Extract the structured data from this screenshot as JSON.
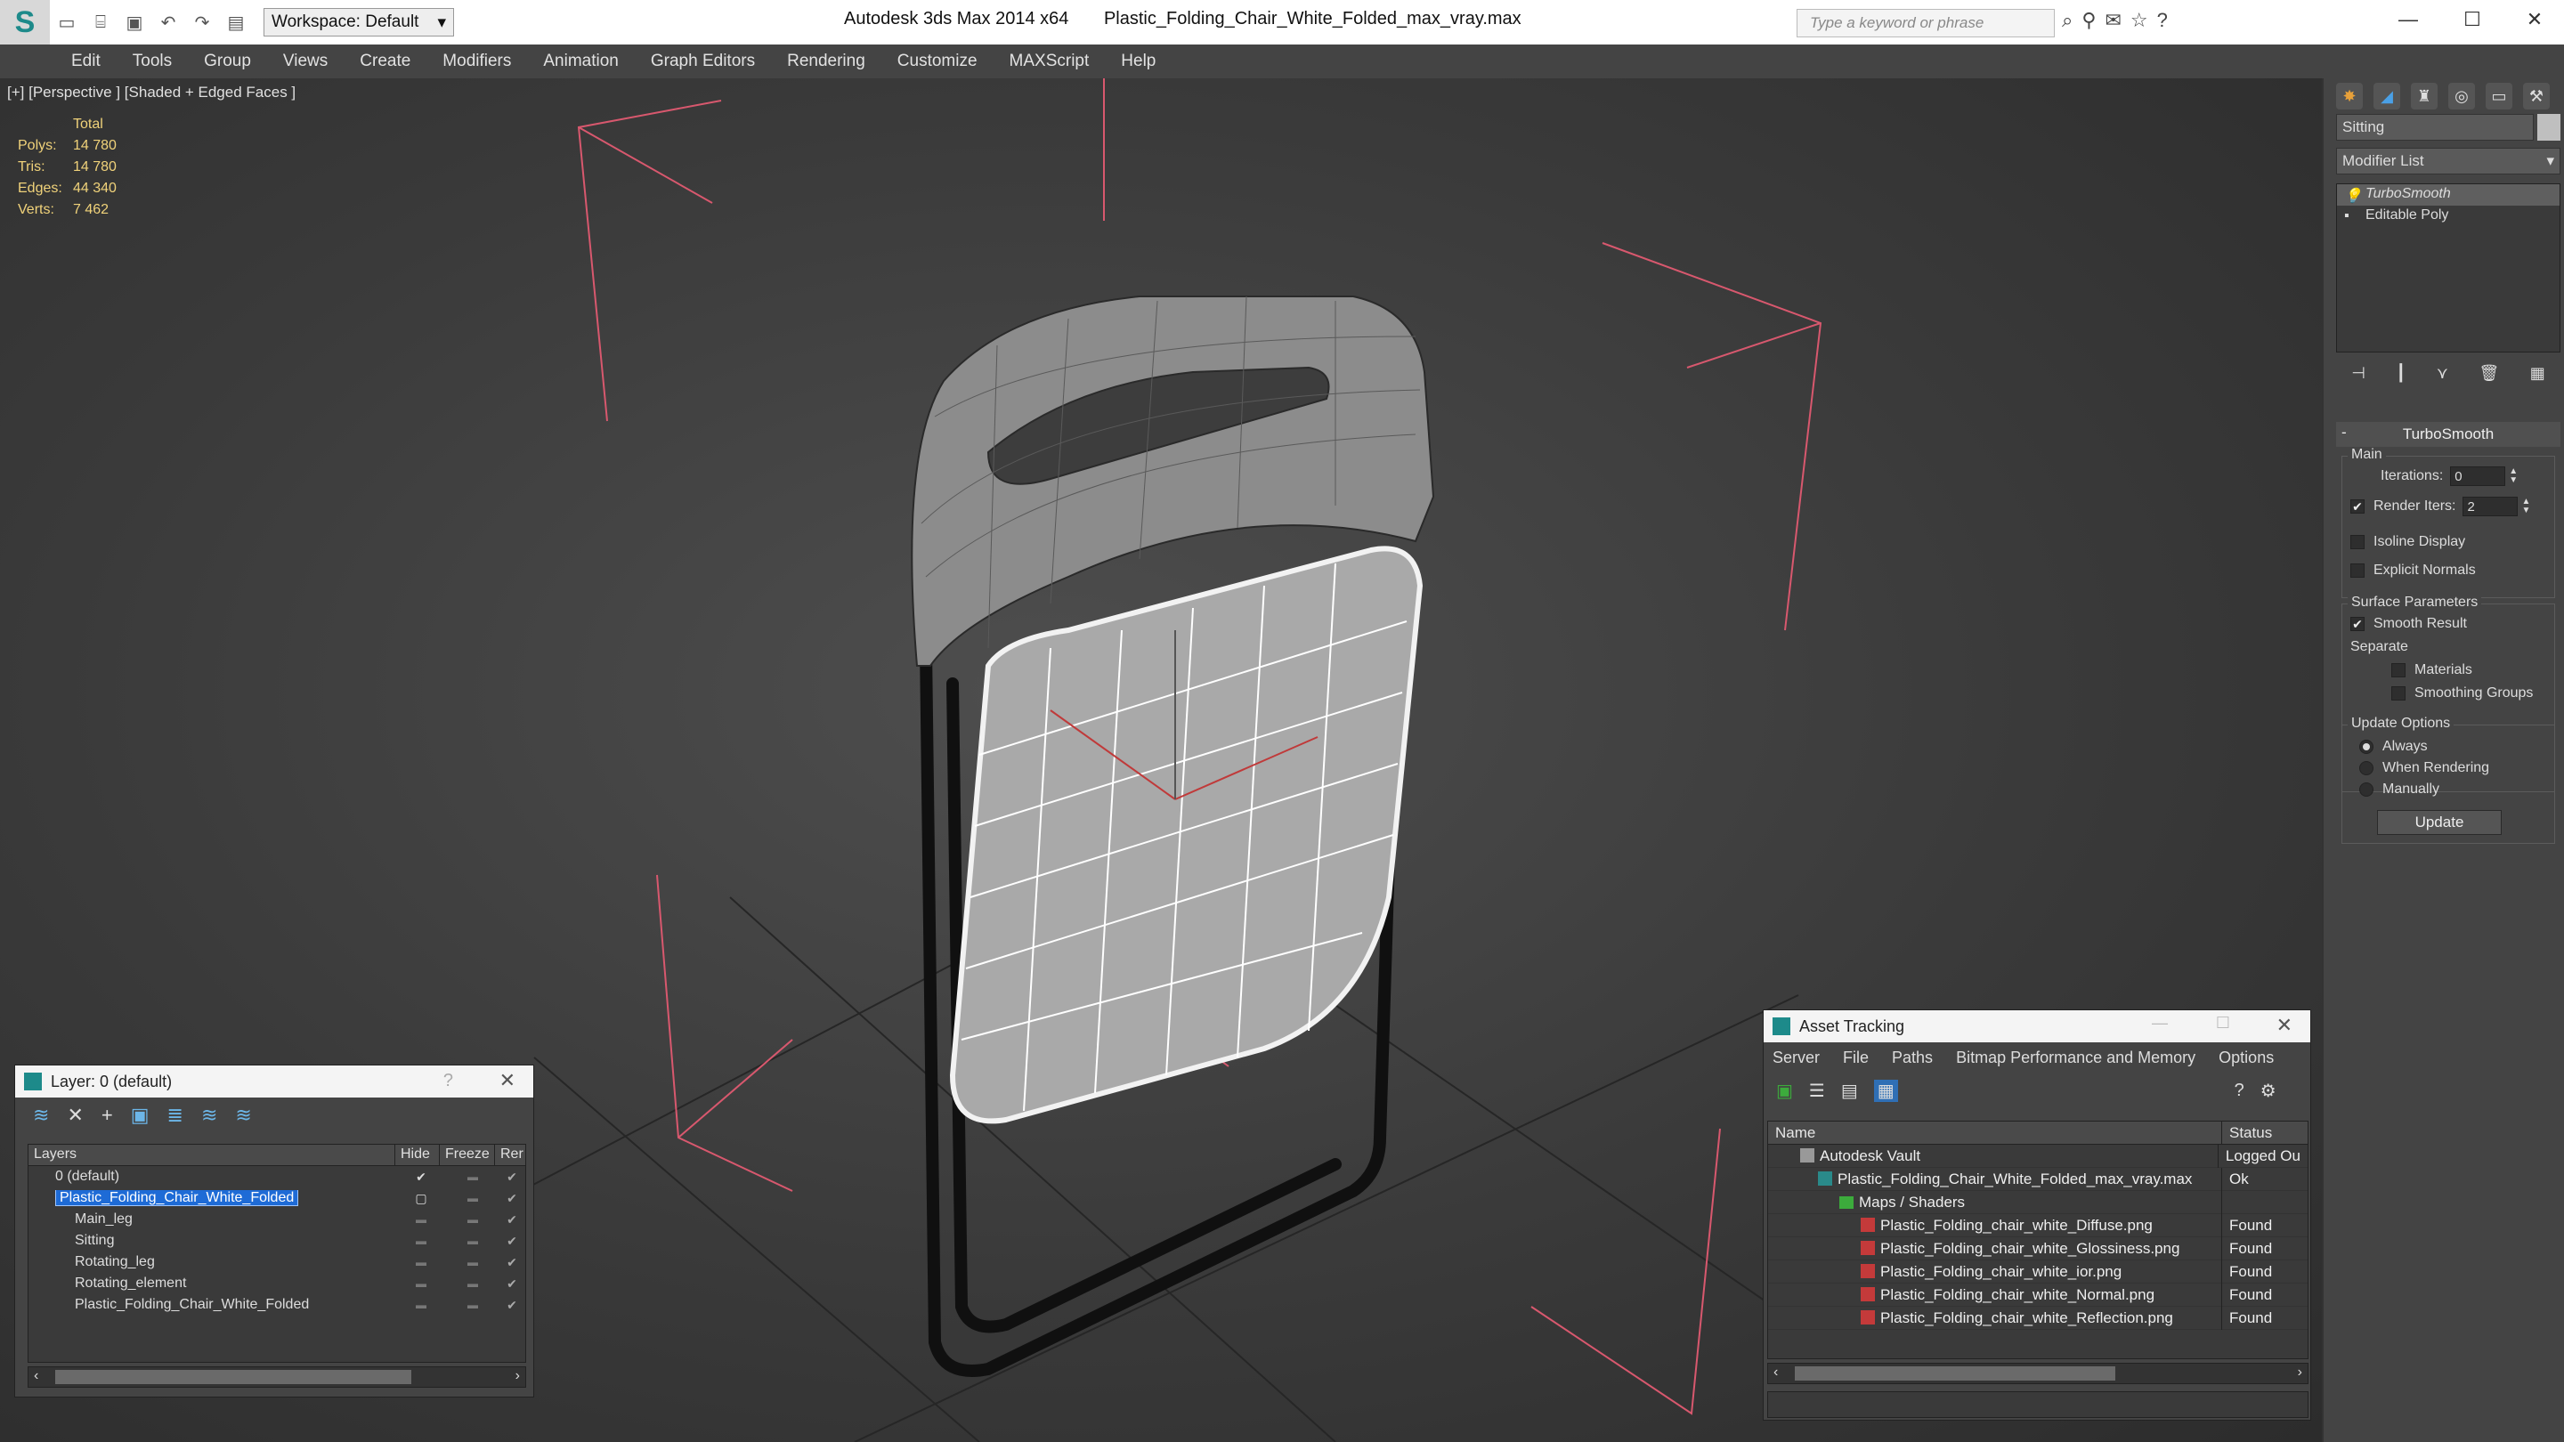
{
  "titlebar": {
    "workspace": "Workspace: Default",
    "app_name": "Autodesk 3ds Max  2014 x64",
    "file_name": "Plastic_Folding_Chair_White_Folded_max_vray.max",
    "search_placeholder": "Type a keyword or phrase"
  },
  "menu": [
    "Edit",
    "Tools",
    "Group",
    "Views",
    "Create",
    "Modifiers",
    "Animation",
    "Graph Editors",
    "Rendering",
    "Customize",
    "MAXScript",
    "Help"
  ],
  "viewport": {
    "label": "[+] [Perspective ] [Shaded + Edged Faces ]",
    "stats_header": "Total",
    "stats": [
      {
        "k": "Polys:",
        "v": "14 780"
      },
      {
        "k": "Tris:",
        "v": "14 780"
      },
      {
        "k": "Edges:",
        "v": "44 340"
      },
      {
        "k": "Verts:",
        "v": "7 462"
      }
    ]
  },
  "command_panel": {
    "object_name": "Sitting",
    "modifier_list": "Modifier List",
    "stack": [
      {
        "label": "TurboSmooth",
        "selected": true
      },
      {
        "label": "Editable Poly",
        "selected": false
      }
    ],
    "rollout_title": "TurboSmooth",
    "main_group": "Main",
    "iterations_label": "Iterations:",
    "iterations_value": "0",
    "render_iters_label": "Render Iters:",
    "render_iters_value": "2",
    "isoline_label": "Isoline Display",
    "explicit_normals_label": "Explicit Normals",
    "surface_group": "Surface Parameters",
    "smooth_result_label": "Smooth Result",
    "separate_label": "Separate",
    "materials_label": "Materials",
    "smoothing_groups_label": "Smoothing Groups",
    "update_group": "Update Options",
    "always_label": "Always",
    "when_rendering_label": "When Rendering",
    "manually_label": "Manually",
    "update_button": "Update"
  },
  "layer_dialog": {
    "title": "Layer: 0 (default)",
    "col_layers": "Layers",
    "col_hide": "Hide",
    "col_freeze": "Freeze",
    "col_render": "Rer",
    "rows": [
      {
        "name": "0 (default)",
        "indent": 1,
        "selected": false,
        "mark": "✔"
      },
      {
        "name": "Plastic_Folding_Chair_White_Folded",
        "indent": 1,
        "selected": true,
        "mark": "▢"
      },
      {
        "name": "Main_leg",
        "indent": 2,
        "selected": false,
        "mark": ""
      },
      {
        "name": "Sitting",
        "indent": 2,
        "selected": false,
        "mark": ""
      },
      {
        "name": "Rotating_leg",
        "indent": 2,
        "selected": false,
        "mark": ""
      },
      {
        "name": "Rotating_element",
        "indent": 2,
        "selected": false,
        "mark": ""
      },
      {
        "name": "Plastic_Folding_Chair_White_Folded",
        "indent": 2,
        "selected": false,
        "mark": ""
      }
    ]
  },
  "asset_dialog": {
    "title": "Asset Tracking",
    "menu": [
      "Server",
      "File",
      "Paths",
      "Bitmap Performance and Memory",
      "Options"
    ],
    "col_name": "Name",
    "col_status": "Status",
    "rows": [
      {
        "name": "Autodesk Vault",
        "status": "Logged Ou",
        "indent": 0,
        "icon": "vault"
      },
      {
        "name": "Plastic_Folding_Chair_White_Folded_max_vray.max",
        "status": "Ok",
        "indent": 1,
        "icon": "max"
      },
      {
        "name": "Maps / Shaders",
        "status": "",
        "indent": 2,
        "icon": "folder"
      },
      {
        "name": "Plastic_Folding_chair_white_Diffuse.png",
        "status": "Found",
        "indent": 3,
        "icon": "png"
      },
      {
        "name": "Plastic_Folding_chair_white_Glossiness.png",
        "status": "Found",
        "indent": 3,
        "icon": "png"
      },
      {
        "name": "Plastic_Folding_chair_white_ior.png",
        "status": "Found",
        "indent": 3,
        "icon": "png"
      },
      {
        "name": "Plastic_Folding_chair_white_Normal.png",
        "status": "Found",
        "indent": 3,
        "icon": "png"
      },
      {
        "name": "Plastic_Folding_chair_white_Reflection.png",
        "status": "Found",
        "indent": 3,
        "icon": "png"
      }
    ]
  }
}
